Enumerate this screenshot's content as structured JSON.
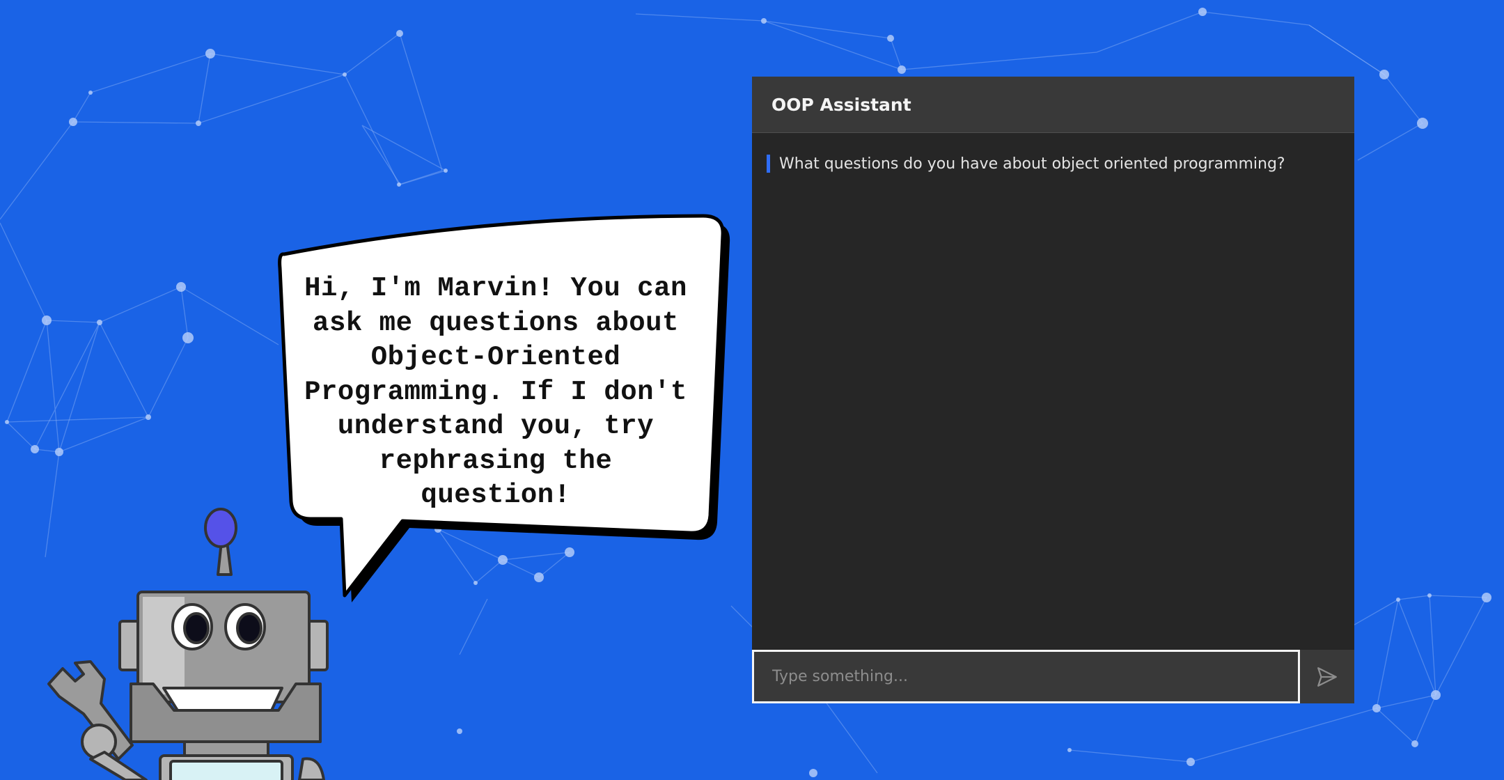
{
  "colors": {
    "background": "#1a63e6",
    "panel": "#262626",
    "panel_header": "#393939",
    "accent": "#2f6df6",
    "text": "#f4f4f4"
  },
  "bubble": {
    "lines": [
      "Hi, I'm Marvin! You can",
      "ask me questions about",
      "Object-Oriented",
      "Programming. If I don't",
      "understand you, try",
      "rephrasing the",
      "question!"
    ]
  },
  "chat": {
    "title": "OOP Assistant",
    "messages": [
      {
        "text": "What questions do you have about object oriented programming?"
      }
    ],
    "input": {
      "placeholder": "Type something...",
      "value": ""
    },
    "send_icon": "send-icon"
  }
}
